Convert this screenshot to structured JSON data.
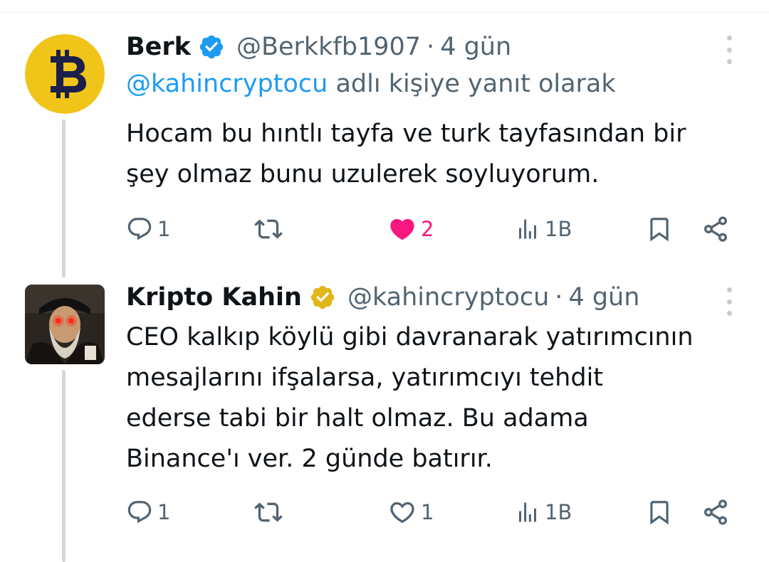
{
  "tweets": [
    {
      "name": "Berk",
      "handle": "@Berkkfb1907",
      "separator": "·",
      "time": "4 gün",
      "reply_mention": "@kahincryptocu",
      "reply_suffix": "adlı kişiye yanıt olarak",
      "text_lines": [
        "Hocam bu hıntlı tayfa ve turk tayfasından bir",
        "şey olmaz bunu uzulerek soyluyorum."
      ],
      "badge": "verified-blue",
      "avatar": "bitcoin-logo-icon",
      "actions": {
        "replies": "1",
        "retweets": "",
        "likes": "2",
        "liked": true,
        "views": "1B"
      }
    },
    {
      "name": "Kripto Kahin",
      "handle": "@kahincryptocu",
      "separator": "·",
      "time": "4 gün",
      "text_lines": [
        "CEO kalkıp köylü gibi davranarak yatırımcının",
        "mesajlarını ifşalarsa, yatırımcıyı tehdit",
        "ederse tabi bir halt olmaz. Bu adama",
        "Binance'ı ver. 2 günde batırır."
      ],
      "badge": "verified-gold",
      "avatar": "nostradamus-portrait",
      "actions": {
        "replies": "1",
        "retweets": "",
        "likes": "1",
        "liked": false,
        "views": "1B"
      }
    }
  ],
  "colors": {
    "link": "#1d9bf0",
    "like": "#f91880",
    "muted": "#536471",
    "gold": "#e2b719",
    "blue": "#1d9bf0"
  }
}
